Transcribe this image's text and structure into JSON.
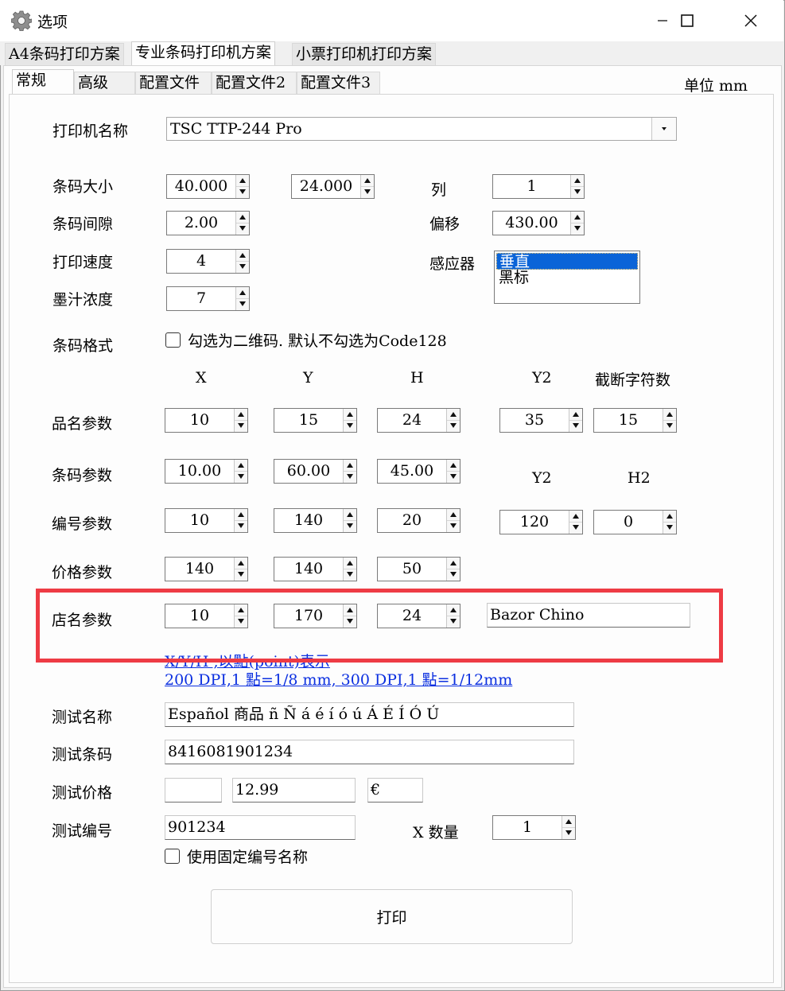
{
  "window": {
    "title": "选项"
  },
  "top_tabs": [
    "A4条码打印方案",
    "专业条码打印机方案",
    "小票打印机打印方案"
  ],
  "sub_tabs": [
    "常规",
    "高级",
    "配置文件",
    "配置文件2",
    "配置文件3"
  ],
  "unit_label": "单位 mm",
  "printer": {
    "label": "打印机名称",
    "value": "TSC TTP-244 Pro"
  },
  "barcode_size": {
    "label": "条码大小",
    "width": "40.000",
    "height": "24.000"
  },
  "columns": {
    "label": "列",
    "value": "1"
  },
  "barcode_gap": {
    "label": "条码间隙",
    "value": "2.00"
  },
  "offset": {
    "label": "偏移",
    "value": "430.00"
  },
  "print_speed": {
    "label": "打印速度",
    "value": "4"
  },
  "sensor": {
    "label": "感应器",
    "options": [
      "垂直",
      "黑标"
    ],
    "selected": "垂直"
  },
  "ink_density": {
    "label": "墨汁浓度",
    "value": "7"
  },
  "barcode_format": {
    "label": "条码格式",
    "checkbox_label": "勾选为二维码. 默认不勾选为Code128",
    "checked": false
  },
  "col_headers": {
    "x": "X",
    "y": "Y",
    "h": "H",
    "y2": "Y2",
    "truncate": "截断字符数",
    "y2b": "Y2",
    "h2": "H2"
  },
  "params": {
    "name": {
      "label": "品名参数",
      "x": "10",
      "y": "15",
      "h": "24",
      "y2": "35",
      "truncate": "15"
    },
    "barcode": {
      "label": "条码参数",
      "x": "10.00",
      "y": "60.00",
      "h": "45.00"
    },
    "number": {
      "label": "编号参数",
      "x": "10",
      "y": "140",
      "h": "20",
      "y2": "120",
      "h2": "0"
    },
    "price": {
      "label": "价格参数",
      "x": "140",
      "y": "140",
      "h": "50"
    },
    "shop": {
      "label": "店名参数",
      "x": "10",
      "y": "170",
      "h": "24",
      "name": "Bazor Chino"
    }
  },
  "notes": {
    "line1": "X/Y/H ,以點(point)表示",
    "line2": "200 DPI,1 點=1/8 mm, 300 DPI,1 點=1/12mm"
  },
  "test": {
    "name_label": "测试名称",
    "name_value": "Español 商品 ñ Ñ á é í ó ú Á É Í Ó Ú",
    "barcode_label": "测试条码",
    "barcode_value": "8416081901234",
    "price_label": "测试价格",
    "price_prefix": "",
    "price_value": "12.99",
    "price_currency": "€",
    "number_label": "测试编号",
    "number_value": "901234",
    "qty_label": "X 数量",
    "qty_value": "1",
    "fixed_label": "使用固定编号名称",
    "fixed_checked": false
  },
  "print_button": "打印",
  "colors": {
    "highlight": "#ee3b44",
    "selection": "#0a64d8",
    "link": "#0b2fe0"
  }
}
